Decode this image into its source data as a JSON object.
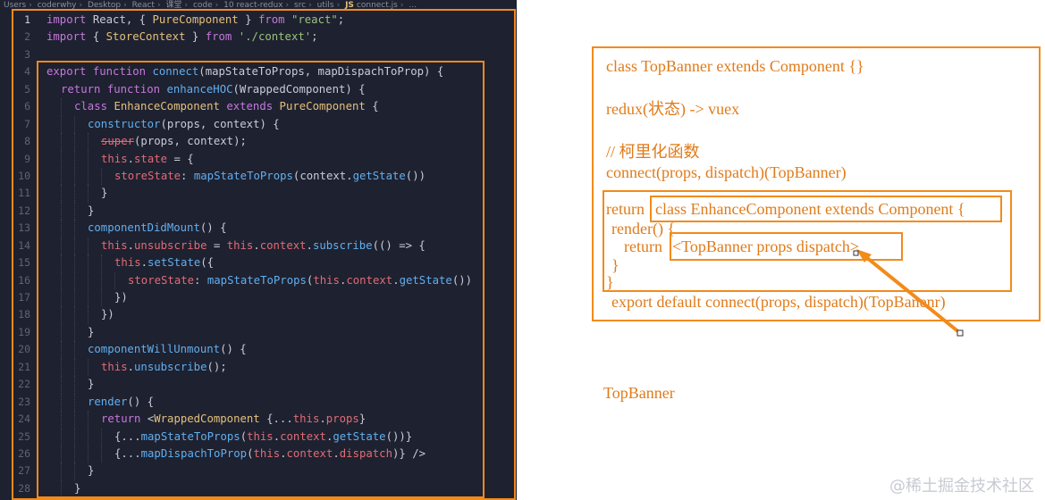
{
  "breadcrumb": [
    "Users",
    "coderwhy",
    "Desktop",
    "React",
    "课堂",
    "code",
    "10 react-redux",
    "src",
    "utils",
    "connect.js",
    "..."
  ],
  "breadcrumb_file_badge": "JS",
  "line_numbers": [
    "1",
    "2",
    "3",
    "4",
    "5",
    "6",
    "7",
    "8",
    "9",
    "10",
    "11",
    "12",
    "13",
    "14",
    "15",
    "16",
    "17",
    "18",
    "19",
    "20",
    "21",
    "22",
    "23",
    "24",
    "25",
    "26",
    "27",
    "28"
  ],
  "code": {
    "l1": {
      "k1": "import",
      "p1": " React, { ",
      "c1": "PureComponent",
      "p2": " } ",
      "k2": "from",
      "p3": " ",
      "s1": "\"react\"",
      "p4": ";"
    },
    "l2": {
      "k1": "import",
      "p1": " { ",
      "c1": "StoreContext",
      "p2": " } ",
      "k2": "from",
      "p3": " ",
      "s1": "'./context'",
      "p4": ";"
    },
    "l4": {
      "k1": "export",
      "p0": " ",
      "k2": "function",
      "p1": " ",
      "f1": "connect",
      "p2": "(mapStateToProps, mapDispachToProp) {"
    },
    "l5": {
      "k1": "return",
      "p0": " ",
      "k2": "function",
      "p1": " ",
      "f1": "enhanceHOC",
      "p2": "(WrappedComponent) {"
    },
    "l6": {
      "k1": "class",
      "p1": " ",
      "c1": "EnhanceComponent",
      "p2": " ",
      "k2": "extends",
      "p3": " ",
      "c2": "PureComponent",
      "p4": " {"
    },
    "l7": {
      "f1": "constructor",
      "p1": "(props, context) {"
    },
    "l8": {
      "x1": "super",
      "p1": "(props, context);"
    },
    "l9": {
      "t1": "this",
      "p1": ".",
      "r1": "state",
      "p2": " = {"
    },
    "l10": {
      "r1": "storeState",
      "p1": ": ",
      "f1": "mapStateToProps",
      "p2": "(context.",
      "f2": "getState",
      "p3": "())"
    },
    "l11": {
      "p1": "}"
    },
    "l12": {
      "p1": "}"
    },
    "l13": {
      "f1": "componentDidMount",
      "p1": "() {"
    },
    "l14": {
      "t1": "this",
      "p1": ".",
      "r1": "unsubscribe",
      "p2": " = ",
      "t2": "this",
      "p3": ".",
      "r2": "context",
      "p4": ".",
      "f1": "subscribe",
      "p5": "(() => {"
    },
    "l15": {
      "t1": "this",
      "p1": ".",
      "f1": "setState",
      "p2": "({"
    },
    "l16": {
      "r1": "storeState",
      "p1": ": ",
      "f1": "mapStateToProps",
      "p2": "(",
      "t1": "this",
      "p3": ".",
      "r2": "context",
      "p4": ".",
      "f2": "getState",
      "p5": "())"
    },
    "l17": {
      "p1": "})"
    },
    "l18": {
      "p1": "})"
    },
    "l19": {
      "p1": "}"
    },
    "l20": {
      "f1": "componentWillUnmount",
      "p1": "() {"
    },
    "l21": {
      "t1": "this",
      "p1": ".",
      "f1": "unsubscribe",
      "p2": "();"
    },
    "l22": {
      "p1": "}"
    },
    "l23": {
      "f1": "render",
      "p1": "() {"
    },
    "l24": {
      "k1": "return",
      "p1": " <",
      "j1": "WrappedComponent",
      "p2": " {...",
      "t1": "this",
      "p3": ".",
      "r1": "props",
      "p4": "}"
    },
    "l25": {
      "p1": "{...",
      "f1": "mapStateToProps",
      "p2": "(",
      "t1": "this",
      "p3": ".",
      "r1": "context",
      "p4": ".",
      "f2": "getState",
      "p5": "())}"
    },
    "l26": {
      "p1": "{...",
      "f1": "mapDispachToProp",
      "p2": "(",
      "t1": "this",
      "p3": ".",
      "r1": "context",
      "p4": ".",
      "r2": "dispatch",
      "p5": ")} />"
    },
    "l27": {
      "p1": "}"
    },
    "l28": {
      "p1": "}"
    }
  },
  "whiteboard": {
    "line1": "class TopBanner extends Component {}",
    "line2": "redux(状态) -> vuex",
    "line3": "// 柯里化函数",
    "line4": "connect(props, dispatch)(TopBanner)",
    "return_kw": "return",
    "line5": "class EnhanceComponent extends Component {",
    "line6": "render() {",
    "line7_kw": "return",
    "line7": "<TopBanner  props  dispatch>",
    "line8": "}",
    "line9": "}",
    "line10": "export default connect(props, dispatch)(TopBanenr)",
    "line11": "TopBanner"
  },
  "watermark": "@稀土掘金技术社区",
  "colors": {
    "accent_orange": "#f28b1a",
    "editor_bg": "#1e2130",
    "keyword": "#c678dd",
    "function": "#61afef",
    "class": "#e5c07b",
    "string": "#98c379",
    "this": "#e06c75"
  }
}
